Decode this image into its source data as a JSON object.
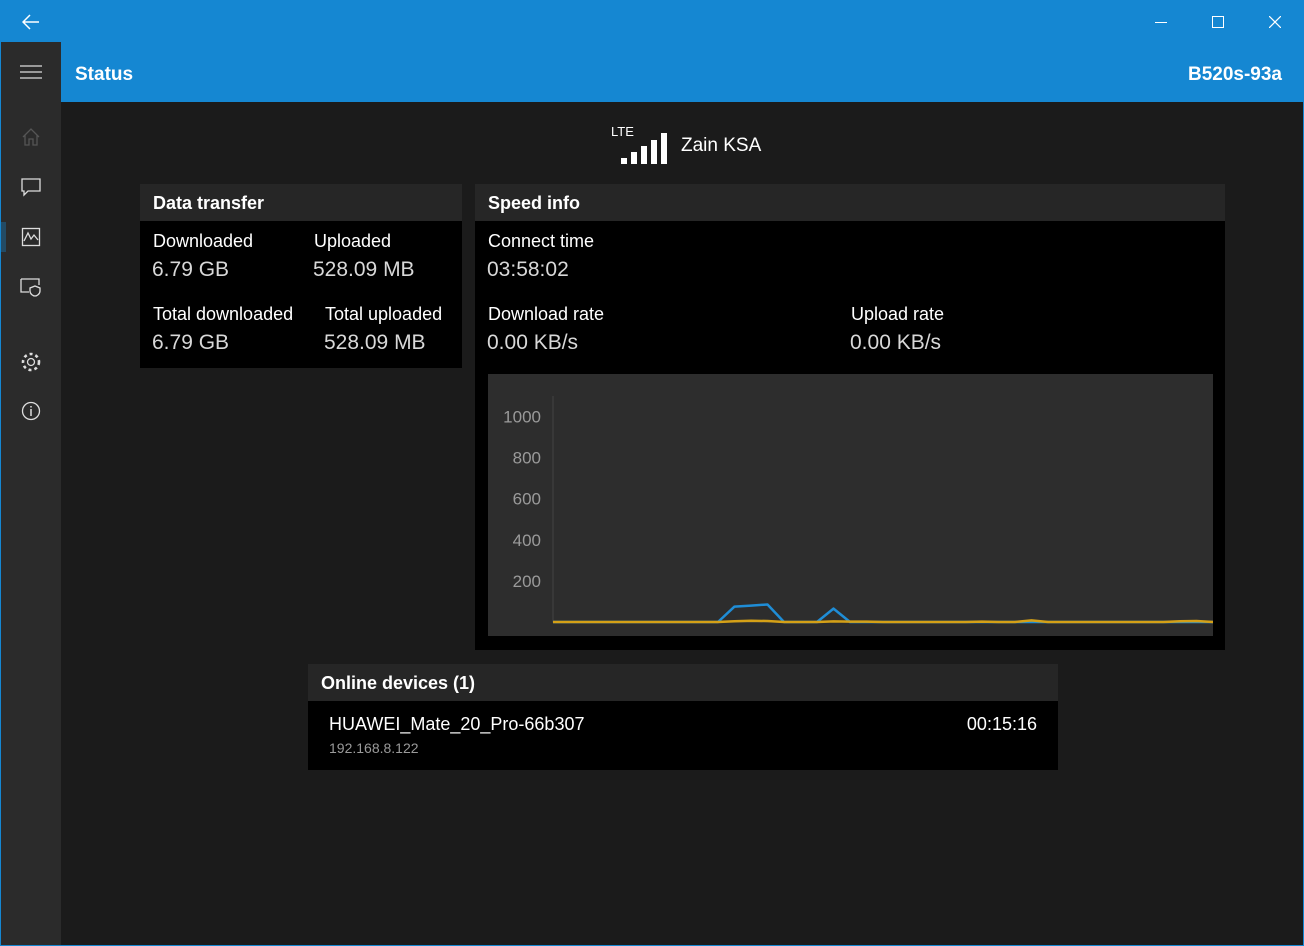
{
  "header": {
    "title": "Status",
    "device": "B520s-93a"
  },
  "connection": {
    "network_type": "LTE",
    "carrier": "Zain KSA",
    "signal_bars": 5
  },
  "data_transfer": {
    "title": "Data transfer",
    "downloaded_label": "Downloaded",
    "downloaded_value": "6.79 GB",
    "uploaded_label": "Uploaded",
    "uploaded_value": "528.09 MB",
    "total_downloaded_label": "Total downloaded",
    "total_downloaded_value": "6.79 GB",
    "total_uploaded_label": "Total uploaded",
    "total_uploaded_value": "528.09 MB"
  },
  "speed_info": {
    "title": "Speed info",
    "connect_time_label": "Connect time",
    "connect_time_value": "03:58:02",
    "download_rate_label": "Download rate",
    "download_rate_value": "0.00 KB/s",
    "upload_rate_label": "Upload rate",
    "upload_rate_value": "0.00 KB/s"
  },
  "chart_data": {
    "type": "line",
    "title": "",
    "xlabel": "",
    "ylabel": "",
    "ylim": [
      0,
      1100
    ],
    "yticks": [
      200,
      400,
      600,
      800,
      1000
    ],
    "grid": false,
    "x": [
      0,
      1,
      2,
      3,
      4,
      5,
      6,
      7,
      8,
      9,
      10,
      11,
      12,
      13,
      14,
      15,
      16,
      17,
      18,
      19,
      20,
      21,
      22,
      23,
      24,
      25,
      26,
      27,
      28,
      29,
      30,
      31,
      32,
      33,
      34,
      35,
      36,
      37,
      38,
      39,
      40
    ],
    "series": [
      {
        "color": "#1f8dd6",
        "values": [
          0,
          0,
          0,
          0,
          0,
          0,
          0,
          0,
          0,
          0,
          0,
          75,
          80,
          85,
          0,
          0,
          0,
          65,
          0,
          0,
          0,
          0,
          0,
          0,
          0,
          0,
          0,
          0,
          0,
          0,
          0,
          0,
          0,
          0,
          0,
          0,
          0,
          0,
          0,
          0,
          0
        ]
      },
      {
        "color": "#d4a017",
        "values": [
          0,
          0,
          0,
          0,
          0,
          0,
          0,
          0,
          0,
          0,
          0,
          4,
          6,
          5,
          0,
          0,
          0,
          3,
          2,
          2,
          0,
          0,
          0,
          0,
          0,
          0,
          2,
          0,
          0,
          8,
          0,
          0,
          0,
          0,
          0,
          0,
          0,
          0,
          4,
          5,
          0
        ]
      }
    ]
  },
  "online_devices": {
    "title": "Online devices (1)",
    "items": [
      {
        "name": "HUAWEI_Mate_20_Pro-66b307",
        "ip": "192.168.8.122",
        "time": "00:15:16"
      }
    ]
  },
  "icons": {
    "back": "back-arrow-icon",
    "minimize": "minimize-icon",
    "maximize": "maximize-icon",
    "close": "close-icon",
    "menu": "hamburger-menu-icon",
    "home": "home-icon",
    "messages": "message-icon",
    "statistics": "statistics-icon",
    "security": "shield-icon",
    "settings": "gear-icon",
    "about": "info-icon"
  },
  "colors": {
    "accent": "#1587d2",
    "download": "#1f8dd6",
    "upload": "#d4a017"
  }
}
